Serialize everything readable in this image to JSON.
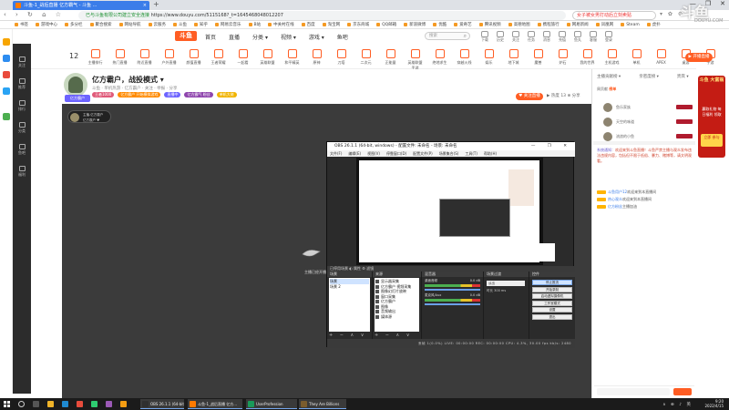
{
  "browser": {
    "tab_title": "斗鱼-1_战后直播 亿方霸气 - 斗鱼 ...",
    "tab_close": "×",
    "new_tab": "+",
    "window_controls": [
      "—",
      "❐",
      "✕"
    ],
    "nav_glyphs": "‹ › ↻ ⌂ ☆",
    "url_prefix": "已与斗鱼有限公司建立安全连接",
    "url": "https://www.douyu.com/5115168?_t=1645468048012207",
    "search_text": "女子被女男打动后立刻卖贴",
    "addr_ctl": "▾ ✿ ⚙ ≡",
    "bookmarks": [
      "书签",
      "游戏中心",
      "多分栏",
      "聚合搜索",
      "网站导航",
      "云服务",
      "斗鱼",
      "知乎",
      "网易云音乐",
      "B站",
      "中关村在线",
      "百度",
      "淘宝网",
      "京东商城",
      "QQ邮箱",
      "新浪微博",
      "优酷",
      "爱奇艺",
      "腾讯视频",
      "高德地图",
      "携程旅行",
      "网易新闻",
      "凤凰网",
      "Steam",
      "虎扑"
    ]
  },
  "douyu": {
    "logo": "斗鱼",
    "nav": [
      "首页",
      "直播",
      "分类 ▾",
      "视频 ▾",
      "游戏 ▾",
      "鱼吧"
    ],
    "search_placeholder": "搜索",
    "search_icon": "⌕",
    "top_icons": [
      "下载",
      "历史",
      "关注",
      "任务",
      "消息",
      "充值",
      "鱼丸",
      "客服",
      "登录"
    ],
    "cat_count": "12",
    "categories": [
      "主播排行",
      "热门直播",
      "附近直播",
      "户外直播",
      "颜值直播",
      "王者荣耀",
      "一起看",
      "英雄联盟",
      "和平精英",
      "原神",
      "刀塔",
      "二次元",
      "正能量",
      "英雄联盟手游",
      "绝地求生",
      "穿越火线",
      "娱乐",
      "地下城",
      "魔兽",
      "炉石",
      "我的世界",
      "主机游戏",
      "单机",
      "APEX",
      "桌游",
      "手游"
    ],
    "login_btn": "▶ 开播直播"
  },
  "room": {
    "title": "亿方霸户，战投模式 ▾",
    "sub": "斗鱼 · 单机热游 · 亿方霸户 · 关注 · 举报 · 分享",
    "level": "亿方霸户",
    "tags": [
      {
        "text": "王者1000",
        "color": "#e05a7a"
      },
      {
        "text": "亿方霸户 开始模拟游戏",
        "color": "#ff8a00"
      },
      {
        "text": "直播中",
        "color": "#6c63ff"
      },
      {
        "text": "亿方霸气 粉丝",
        "color": "#8e44ad"
      },
      {
        "text": "单机大佬",
        "color": "#f1b400"
      }
    ],
    "follow": "♥ 关注直播",
    "stats": "▶ 热度 13 ⊕ 分享"
  },
  "sidebar_dark": [
    "关注",
    "推荐",
    "排行",
    "分类",
    "鱼吧",
    "福利"
  ],
  "player": {
    "anchor_name": "主播-亿方霸户",
    "anchor_sub": "亿方霸户 ♥",
    "mouse_label": "主播已经开播 ⊙"
  },
  "obs": {
    "title": "OBS 26.1.1 (64-bit, windows) - 配置文件: 未命名 - 场景: 未命名",
    "win_controls": "— ❐ ✕",
    "menu": [
      "文件(F)",
      "编辑(E)",
      "视图(V)",
      "停靠窗口(D)",
      "配置文件(P)",
      "场景集合(S)",
      "工具(T)",
      "帮助(H)"
    ],
    "split_label": "已停用场景  ◐ 属性  ⚙ 滤镜",
    "scenes_head": "场景",
    "scenes": [
      "场景",
      "场景 2"
    ],
    "sources_head": "来源",
    "sources": [
      "显示器采集",
      "亿方霸户 视频采集",
      "图像幻灯片放映",
      "窗口采集",
      "亿方霸户",
      "图像",
      "音频输出",
      "媒体源"
    ],
    "mixer_head": "混音器",
    "mixer": [
      {
        "name": "桌面音频",
        "db": "0.0 dB"
      },
      {
        "name": "麦克风/Aux",
        "db": "0.0 dB"
      }
    ],
    "transition_head": "场景过渡",
    "transition_fade": "淡出",
    "transition_dur": "时长 300 ms",
    "controls_head": "控件",
    "controls": [
      "停止推流",
      "开始录制",
      "启动虚拟摄像机",
      "工作室模式",
      "设置",
      "退出"
    ],
    "dock_foot": "+ − ∧ ∨",
    "status": "丢帧 1(0.0%)   LIVE: 00:00:00   REC: 00:00:00   CPU: 4.3%, 30.00 fps   kb/s: 2480"
  },
  "chat": {
    "tabs": [
      "主播贡献榜 ▾",
      "亲密度榜 ▾",
      "贵宾 ▾"
    ],
    "rank_prefix": "周贡献 ",
    "rank_value": "榜单",
    "rank_users": [
      "鱼乐家族",
      "天空的味道",
      "流浪的小鱼"
    ],
    "note_user": "系统通知：",
    "note_text": "欢迎来到斗鱼直播！斗鱼严禁主播与观众发布违法违规内容，包括但不限于低俗、暴力、赌博等，请文明观看。",
    "messages": [
      {
        "user": "斗鱼用户12",
        "text": "欢迎来到本直播间"
      },
      {
        "user": "热心观众",
        "text": "欢迎来到本直播间"
      },
      {
        "user": "亿方粉丝",
        "text": "主播加油"
      }
    ]
  },
  "ad": {
    "title": "斗鱼 大富翁",
    "body": "赢取礼物 每日福利 领取",
    "cta": "立即 参与"
  },
  "watermark": "斗鱼",
  "watermark_url": "DOUYU.COM",
  "taskbar": {
    "apps": [
      "OBS 26.1.1 (64-bit...",
      "斗鱼-1_战后直播 亿方...",
      "UserProfession",
      "They Are Billions"
    ],
    "tray_icons": "∧ ⊕ ♪ 英",
    "time": "9:20",
    "date": "2022/4/15"
  }
}
